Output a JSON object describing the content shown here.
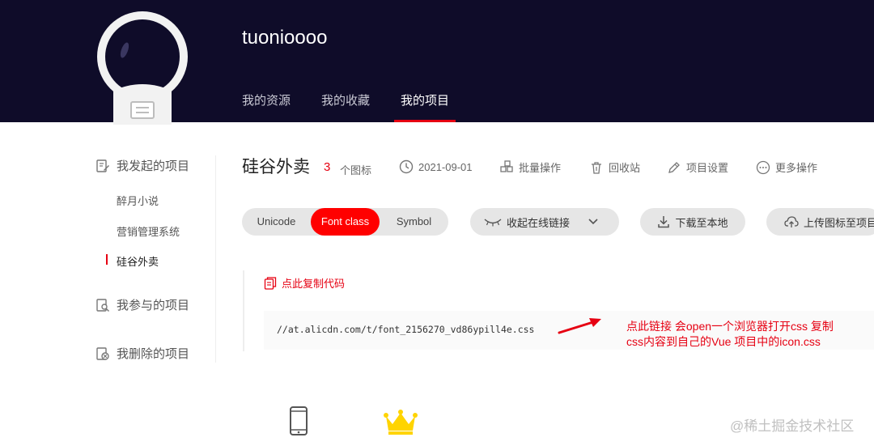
{
  "header": {
    "username": "tuonioooo",
    "tabs": [
      {
        "label": "我的资源",
        "active": false
      },
      {
        "label": "我的收藏",
        "active": false
      },
      {
        "label": "我的项目",
        "active": true
      }
    ],
    "accent_color": "#e60012",
    "background_color": "#0f0c29"
  },
  "sidebar": {
    "groups": [
      {
        "label": "我发起的项目",
        "icon": "edit-doc-icon"
      },
      {
        "label": "我参与的项目",
        "icon": "search-doc-icon"
      },
      {
        "label": "我删除的项目",
        "icon": "delete-doc-icon"
      }
    ],
    "projects": [
      {
        "label": "醉月小说",
        "active": false
      },
      {
        "label": "营销管理系统",
        "active": false
      },
      {
        "label": "硅谷外卖",
        "active": true
      }
    ]
  },
  "project": {
    "title": "硅谷外卖",
    "icon_count": "3",
    "icon_count_label": "个图标",
    "date": "2021-09-01",
    "actions": [
      {
        "label": "批量操作",
        "icon": "batch-icon"
      },
      {
        "label": "回收站",
        "icon": "trash-icon"
      },
      {
        "label": "项目设置",
        "icon": "pencil-icon"
      },
      {
        "label": "更多操作",
        "icon": "more-icon"
      }
    ]
  },
  "toolbar": {
    "formats": [
      {
        "label": "Unicode",
        "active": false
      },
      {
        "label": "Font class",
        "active": true
      },
      {
        "label": "Symbol",
        "active": false
      }
    ],
    "collapse_label": "收起在线链接",
    "download_label": "下载至本地",
    "upload_label": "上传图标至项目"
  },
  "code": {
    "copy_label": "点此复制代码",
    "link": "//at.alicdn.com/t/font_2156270_vd86ypill4e.css"
  },
  "annotation": {
    "line1": "点此链接 会open一个浏览器打开css  复制",
    "line2": "css内容到自己的Vue 项目中的icon.css"
  },
  "watermark": "@稀土掘金技术社区"
}
